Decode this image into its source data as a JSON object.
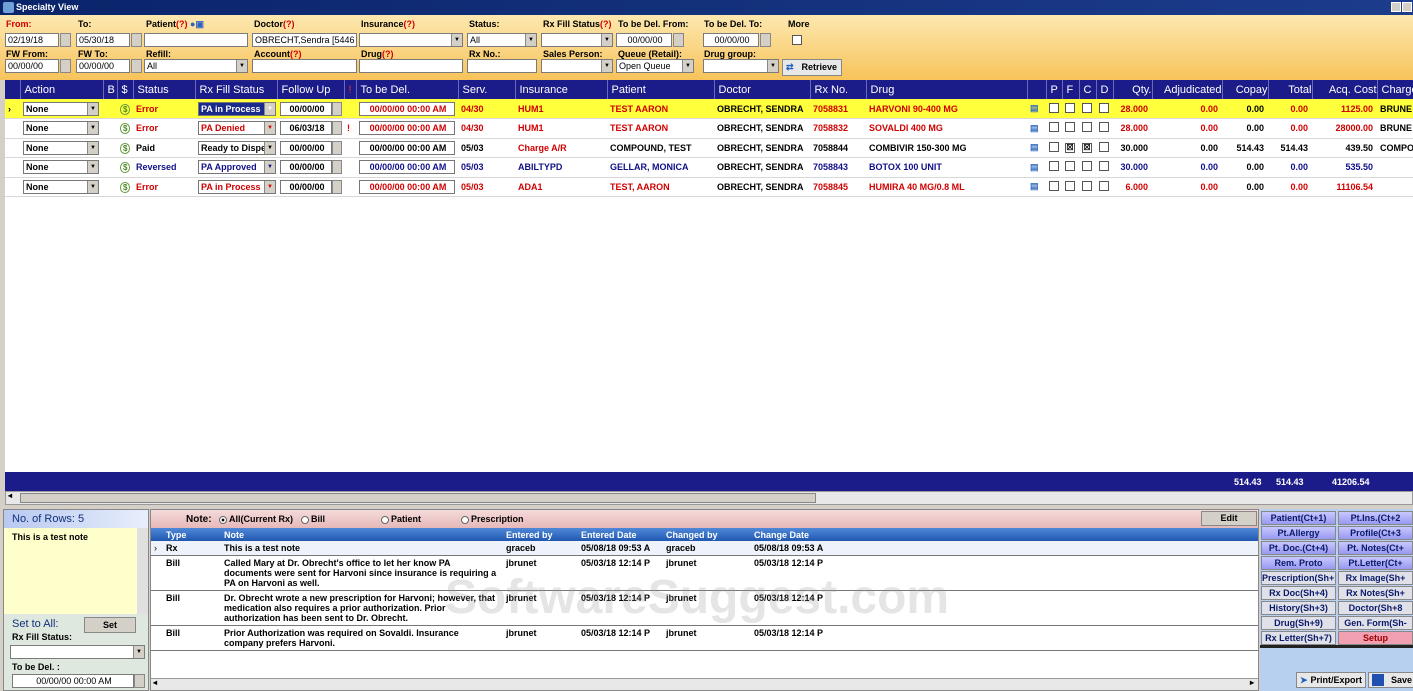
{
  "window": {
    "title": "Specialty View"
  },
  "filters": {
    "from_label": "From:",
    "from": "02/19/18",
    "to_label": "To:",
    "to": "05/30/18",
    "patient_label": "Patient",
    "patient_q": "(?)",
    "patient": "",
    "doctor_label": "Doctor",
    "doctor_q": "(?)",
    "doctor": "OBRECHT,Sendra [5446",
    "insurance_label": "Insurance",
    "insurance_q": "(?)",
    "insurance": "",
    "status_label": "Status:",
    "status": "All",
    "rxfill_label": "Rx Fill Status",
    "rxfill_q": "(?)",
    "rxfill": "",
    "tbd_from_label": "To be Del. From:",
    "tbd_from": "00/00/00",
    "tbd_to_label": "To be Del. To:",
    "tbd_to": "00/00/00",
    "more_label": "More",
    "fw_from_label": "FW From:",
    "fw_from": "00/00/00",
    "fw_to_label": "FW To:",
    "fw_to": "00/00/00",
    "refill_label": "Refill:",
    "refill": "All",
    "account_label": "Account",
    "account_q": "(?)",
    "account": "",
    "drug_label": "Drug",
    "drug_q": "(?)",
    "drug": "",
    "rxno_label": "Rx No.:",
    "rxno": "",
    "sales_label": "Sales Person:",
    "sales": "",
    "queue_label": "Queue (Retail):",
    "queue": "Open Queue",
    "druggroup_label": "Drug group:",
    "druggroup": "",
    "retrieve": "Retrieve"
  },
  "grid": {
    "headers": [
      "",
      "Action",
      "B",
      "$",
      "Status",
      "Rx Fill Status",
      "Follow Up",
      "!",
      "To be Del.",
      "Serv.",
      "Insurance",
      "Patient",
      "Doctor",
      "Rx No.",
      "Drug",
      "",
      "P",
      "F",
      "C",
      "D",
      "Qty.",
      "Adjudicated",
      "Copay",
      "Total",
      "Acq. Cost",
      "Charge"
    ],
    "rows": [
      {
        "selected": true,
        "color": "#d00000",
        "action": "None",
        "status": "Error",
        "rxfill": "PA in Process",
        "follow": "00/00/00",
        "flag": "",
        "tbd": "00/00/00 00:00 AM",
        "serv": "04/30",
        "insurance": "HUM1",
        "patient": "TEST  AARON",
        "doctor": "OBRECHT, SENDRA",
        "rxno": "7058831",
        "drug": "HARVONI 90-400 MG",
        "p": false,
        "f": false,
        "c": false,
        "d": false,
        "qty": "28.000",
        "adj": "0.00",
        "copay": "0.00",
        "total": "0.00",
        "acq": "1125.00",
        "charge": "BRUNE"
      },
      {
        "selected": false,
        "color": "#d00000",
        "action": "None",
        "status": "Error",
        "rxfill": "PA Denied",
        "follow": "06/03/18",
        "flag": "!",
        "tbd": "00/00/00 00:00 AM",
        "serv": "04/30",
        "insurance": "HUM1",
        "patient": "TEST  AARON",
        "doctor": "OBRECHT, SENDRA",
        "rxno": "7058832",
        "drug": "SOVALDI 400 MG",
        "p": false,
        "f": false,
        "c": false,
        "d": false,
        "qty": "28.000",
        "adj": "0.00",
        "copay": "0.00",
        "total": "0.00",
        "acq": "28000.00",
        "charge": "BRUNE"
      },
      {
        "selected": false,
        "color": "#000000",
        "action": "None",
        "status": "Paid",
        "rxfill": "Ready to Dispe",
        "follow": "00/00/00",
        "flag": "",
        "tbd": "00/00/00 00:00 AM",
        "serv": "05/03",
        "insurance": "Charge A/R",
        "patient": "COMPOUND, TEST",
        "doctor": "OBRECHT, SENDRA",
        "rxno": "7058844",
        "drug": "COMBIVIR 150-300 MG",
        "p": false,
        "f": true,
        "c": true,
        "d": false,
        "qty": "30.000",
        "adj": "0.00",
        "copay": "514.43",
        "total": "514.43",
        "acq": "439.50",
        "charge": "COMPO"
      },
      {
        "selected": false,
        "color": "#10108a",
        "action": "None",
        "status": "Reversed",
        "rxfill": "PA Approved",
        "follow": "00/00/00",
        "flag": "",
        "tbd": "00/00/00 00:00 AM",
        "serv": "05/03",
        "insurance": "ABILTYPD",
        "patient": "GELLAR, MONICA",
        "doctor": "OBRECHT, SENDRA",
        "rxno": "7058843",
        "drug": "BOTOX 100 UNIT",
        "p": false,
        "f": false,
        "c": false,
        "d": false,
        "qty": "30.000",
        "adj": "0.00",
        "copay": "0.00",
        "total": "0.00",
        "acq": "535.50",
        "charge": ""
      },
      {
        "selected": false,
        "color": "#d00000",
        "action": "None",
        "status": "Error",
        "rxfill": "PA in Process",
        "follow": "00/00/00",
        "flag": "",
        "tbd": "00/00/00 00:00 AM",
        "serv": "05/03",
        "insurance": "ADA1",
        "patient": "TEST, AARON",
        "doctor": "OBRECHT, SENDRA",
        "rxno": "7058845",
        "drug": "HUMIRA 40 MG/0.8 ML",
        "p": false,
        "f": false,
        "c": false,
        "d": false,
        "qty": "6.000",
        "adj": "0.00",
        "copay": "0.00",
        "total": "0.00",
        "acq": "11106.54",
        "charge": ""
      }
    ],
    "totals": {
      "copay": "514.43",
      "total": "514.43",
      "acq": "41206.54"
    }
  },
  "left": {
    "rows_label": "No. of Rows: 5",
    "note": "This is a test note",
    "set_to_all": "Set to All:",
    "set": "Set",
    "rxfill_label": "Rx Fill Status:",
    "tbd_label": "To be Del. :",
    "tbd": "00/00/00 00:00 AM"
  },
  "notes": {
    "note_label": "Note:",
    "radios": [
      "All(Current Rx)",
      "Bill",
      "Patient",
      "Prescription"
    ],
    "edit": "Edit",
    "headers": [
      "Type",
      "Note",
      "Entered by",
      "Entered Date",
      "Changed by",
      "Change Date"
    ],
    "rows": [
      [
        "Rx",
        "This is a test note",
        "graceb",
        "05/08/18 09:53 A",
        "graceb",
        "05/08/18 09:53 A"
      ],
      [
        "Bill",
        "Called Mary at Dr. Obrecht's office to let her know PA documents were sent for Harvoni since insurance is requiring a PA on Harvoni as well.",
        "jbrunet",
        "05/03/18 12:14 P",
        "jbrunet",
        "05/03/18 12:14 P"
      ],
      [
        "Bill",
        "Dr. Obrecht wrote a new prescription for Harvoni; however, that medication also requires a prior authorization. Prior authorization has been sent to Dr. Obrecht.",
        "jbrunet",
        "05/03/18 12:14 P",
        "jbrunet",
        "05/03/18 12:14 P"
      ],
      [
        "Bill",
        "Prior Authorization was required on Sovaldi. Insurance company prefers Harvoni.",
        "jbrunet",
        "05/03/18 12:14 P",
        "jbrunet",
        "05/03/18 12:14 P"
      ]
    ]
  },
  "actions": {
    "buttons": [
      {
        "label": "Patient(Ct+1)",
        "style": "blue"
      },
      {
        "label": "Pt.Ins.(Ct+2",
        "style": "blue"
      },
      {
        "label": "Pt.Allergy",
        "style": "blue"
      },
      {
        "label": "Profile(Ct+3",
        "style": "blue"
      },
      {
        "label": "Pt. Doc.(Ct+4)",
        "style": "blue"
      },
      {
        "label": "Pt. Notes(Ct+",
        "style": "blue"
      },
      {
        "label": "Rem. Proto",
        "style": "blue"
      },
      {
        "label": "Pt.Letter(Ct+",
        "style": "blue"
      },
      {
        "label": "Prescription(Sh+1)",
        "style": "grey"
      },
      {
        "label": "Rx Image(Sh+",
        "style": "grey"
      },
      {
        "label": "Rx Doc(Sh+4)",
        "style": "grey"
      },
      {
        "label": "Rx Notes(Sh+",
        "style": "grey"
      },
      {
        "label": "History(Sh+3)",
        "style": "grey"
      },
      {
        "label": "Doctor(Sh+8",
        "style": "grey"
      },
      {
        "label": "Drug(Sh+9)",
        "style": "grey"
      },
      {
        "label": "Gen. Form(Sh-",
        "style": "grey"
      },
      {
        "label": "Rx Letter(Sh+7)",
        "style": "grey"
      },
      {
        "label": "Setup",
        "style": "pink"
      }
    ],
    "print": "Print/Export",
    "save": "Save"
  },
  "watermark": "SoftwareSuggest.com"
}
